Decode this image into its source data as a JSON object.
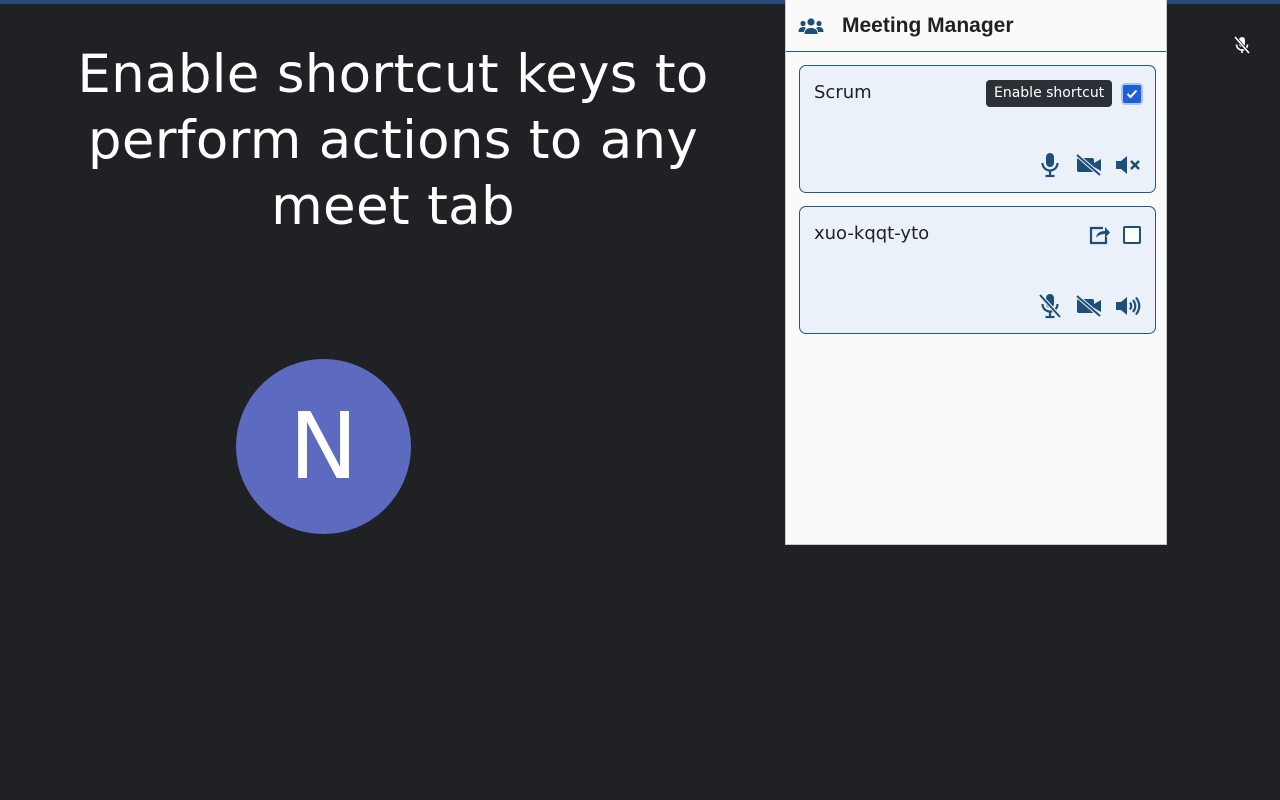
{
  "page": {
    "headline": "Enable shortcut keys to perform actions to any meet tab",
    "avatar_initial": "N"
  },
  "panel": {
    "title": "Meeting Manager",
    "header_icon": "people-group-icon",
    "meetings": [
      {
        "name": "Scrum",
        "shortcut_enabled": true,
        "tooltip": "Enable shortcut",
        "mic": "on",
        "camera": "off",
        "speaker": "muted"
      },
      {
        "name": "xuo-kqqt-yto",
        "shortcut_enabled": false,
        "mic": "off",
        "camera": "off",
        "speaker": "on"
      }
    ]
  },
  "colors": {
    "background": "#202124",
    "accent": "#1f5a87",
    "avatar": "#5c6bc0",
    "checkbox_checked": "#1f5fd6"
  }
}
